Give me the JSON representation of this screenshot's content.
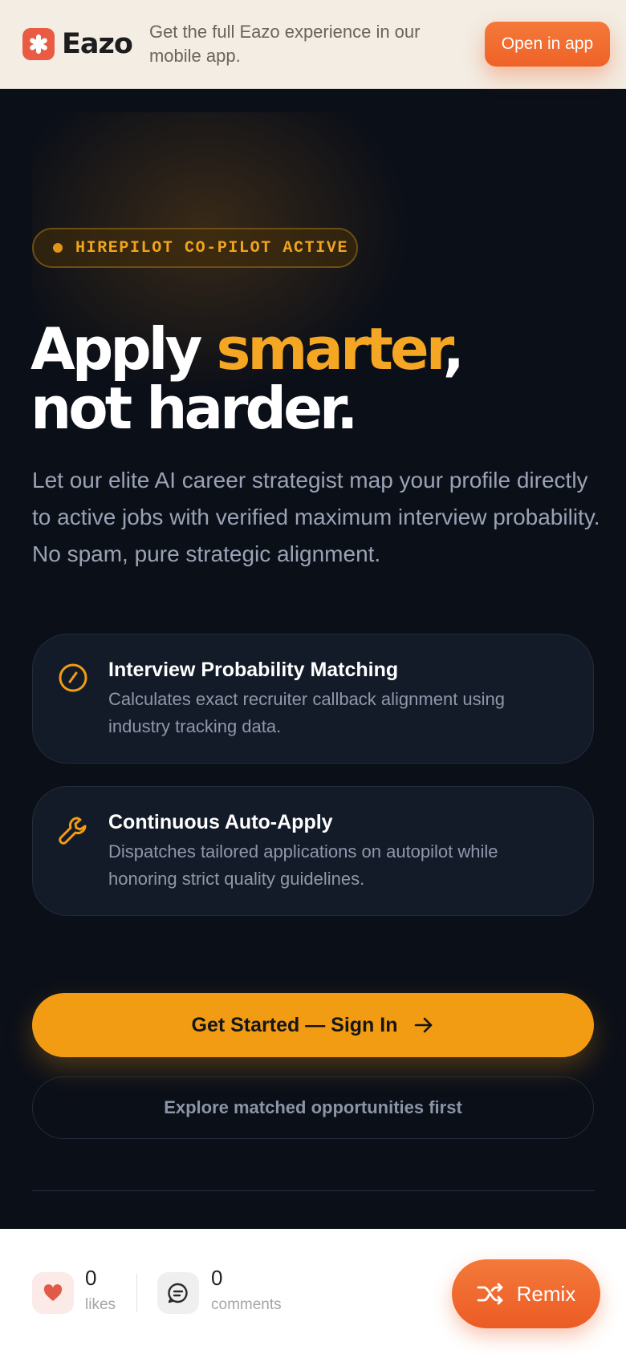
{
  "banner": {
    "brand": "Eazo",
    "message": "Get the full Eazo experience in our mobile app.",
    "open_button": "Open in app"
  },
  "hero": {
    "badge": "HIREPILOT CO-PILOT ACTIVE",
    "headline_part1": "Apply ",
    "headline_accent": "smarter",
    "headline_part2": ",",
    "headline_line2": "not harder.",
    "subtitle": "Let our elite AI career strategist map your profile directly to active jobs with verified maximum interview probability. No spam, pure strategic alignment."
  },
  "features": [
    {
      "icon": "gauge-icon",
      "title": "Interview Probability Matching",
      "description": "Calculates exact recruiter callback alignment using industry tracking data."
    },
    {
      "icon": "wrench-icon",
      "title": "Continuous Auto-Apply",
      "description": "Dispatches tailored applications on autopilot while honoring strict quality guidelines."
    }
  ],
  "cta": {
    "primary": "Get Started — Sign In",
    "secondary": "Explore matched opportunities first"
  },
  "bottom_bar": {
    "likes_count": "0",
    "likes_label": "likes",
    "comments_count": "0",
    "comments_label": "comments",
    "remix": "Remix"
  },
  "colors": {
    "background": "#0b0f18",
    "accent": "#f5a623",
    "brand_orange": "#ef6227",
    "card": "#131b29"
  }
}
